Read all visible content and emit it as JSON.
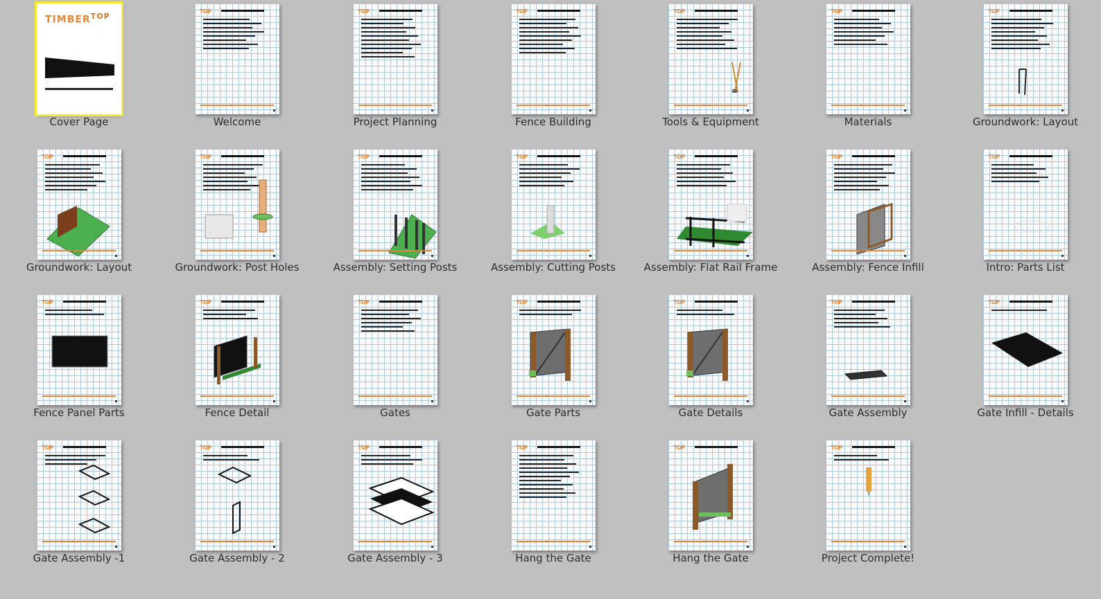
{
  "cover": {
    "logo_text": "TIMBER",
    "logo_text_2": "TOP"
  },
  "pages": [
    {
      "label": "Cover Page",
      "selected": true,
      "lines": 0,
      "illus": "cover"
    },
    {
      "label": "Welcome",
      "lines": 8,
      "illus": "none"
    },
    {
      "label": "Project Planning",
      "lines": 10,
      "illus": "none"
    },
    {
      "label": "Fence Building",
      "lines": 9,
      "illus": "none"
    },
    {
      "label": "Tools & Equipment",
      "lines": 8,
      "illus": "tools"
    },
    {
      "label": "Materials",
      "lines": 7,
      "illus": "none"
    },
    {
      "label": "Groundwork: Layout",
      "lines": 8,
      "illus": "stake"
    },
    {
      "label": "Groundwork: Layout",
      "lines": 7,
      "illus": "ground-layout"
    },
    {
      "label": "Groundwork: Post Holes",
      "lines": 7,
      "illus": "post-hole"
    },
    {
      "label": "Assembly: Setting Posts",
      "lines": 7,
      "illus": "setting-posts"
    },
    {
      "label": "Assembly: Cutting Posts",
      "lines": 6,
      "illus": "cutting-posts"
    },
    {
      "label": "Assembly: Flat Rail Frame",
      "lines": 6,
      "illus": "rail-frame"
    },
    {
      "label": "Assembly: Fence Infill",
      "lines": 7,
      "illus": "fence-infill"
    },
    {
      "label": "Intro: Parts List",
      "lines": 5,
      "illus": "parts"
    },
    {
      "label": "Fence Panel Parts",
      "lines": 2,
      "illus": "panel"
    },
    {
      "label": "Fence Detail",
      "lines": 3,
      "illus": "fence-detail"
    },
    {
      "label": "Gates",
      "lines": 6,
      "illus": "none"
    },
    {
      "label": "Gate Parts",
      "lines": 2,
      "illus": "gate"
    },
    {
      "label": "Gate Details",
      "lines": 2,
      "illus": "gate"
    },
    {
      "label": "Gate Assembly",
      "lines": 5,
      "illus": "gate-assembly"
    },
    {
      "label": "Gate Infill - Details",
      "lines": 1,
      "illus": "infill-detail"
    },
    {
      "label": "Gate Assembly -1",
      "lines": 3,
      "illus": "frames3"
    },
    {
      "label": "Gate Assembly - 2",
      "lines": 2,
      "illus": "frames2"
    },
    {
      "label": "Gate Assembly - 3",
      "lines": 3,
      "illus": "stack"
    },
    {
      "label": "Hang the Gate",
      "lines": 11,
      "illus": "none"
    },
    {
      "label": "Hang the Gate",
      "lines": 0,
      "illus": "hang"
    },
    {
      "label": "Project Complete!",
      "lines": 2,
      "illus": "complete"
    }
  ],
  "colors": {
    "background": "#c0c0c0",
    "selected_outline": "#f4ec2a",
    "accent_orange": "#e2873a",
    "grid_blue": "#a9c8de",
    "grass_green": "#4caf50",
    "wood_brown": "#8a5a2b"
  }
}
